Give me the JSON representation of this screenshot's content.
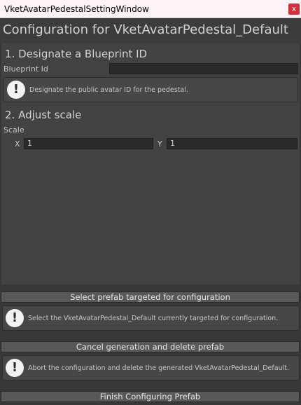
{
  "window": {
    "title": "VketAvatarPedestalSettingWindow",
    "close_glyph": "x"
  },
  "header": {
    "title": "Configuration for VketAvatarPedestal_Default"
  },
  "section1": {
    "heading": "1. Designate a Blueprint ID",
    "field_label": "Blueprint Id",
    "field_value": "",
    "help_text": "Designate the public avatar ID for the pedestal."
  },
  "section2": {
    "heading": "2. Adjust scale",
    "scale_label": "Scale",
    "x_label": "X",
    "x_value": "1",
    "y_label": "Y",
    "y_value": "1"
  },
  "actions": {
    "select_label": "Select prefab targeted for configuration",
    "select_help": "Select the VketAvatarPedestal_Default currently targeted for configuration.",
    "cancel_label": "Cancel generation and delete prefab",
    "cancel_help": "Abort the configuration and delete the generated VketAvatarPedestal_Default.",
    "finish_label": "Finish Configuring Prefab"
  },
  "icons": {
    "info": "!"
  },
  "colors": {
    "close_button": "#d32f3a",
    "background": "#383838"
  }
}
